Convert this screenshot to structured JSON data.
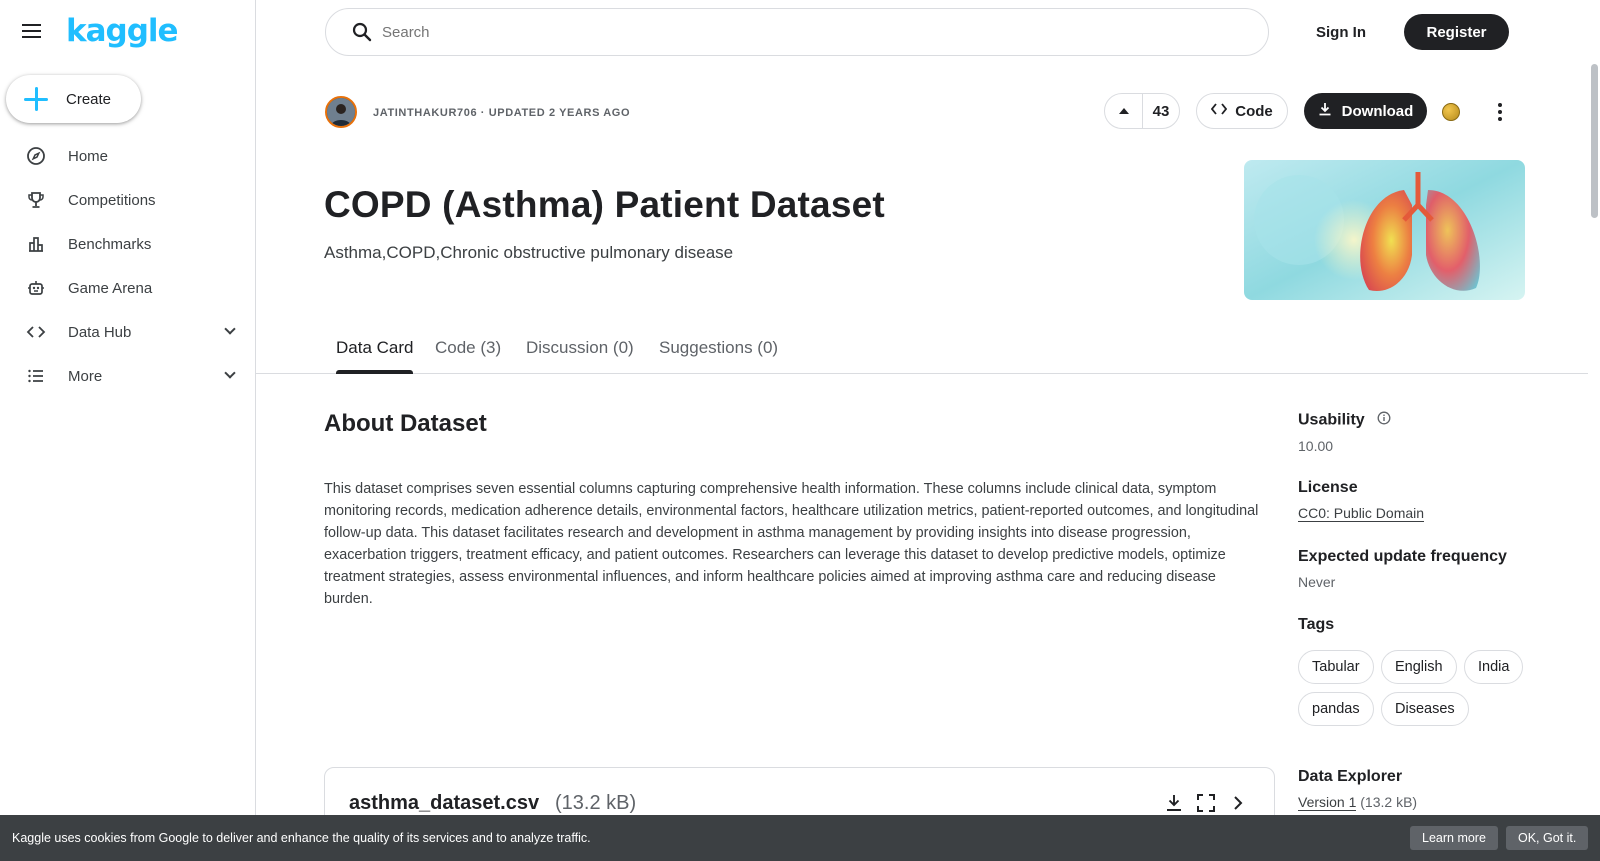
{
  "brand": {
    "logo_text": "kaggle",
    "accent": "#20beff"
  },
  "sidebar": {
    "create_label": "Create",
    "items": [
      {
        "label": "Home",
        "icon": "compass-icon"
      },
      {
        "label": "Competitions",
        "icon": "trophy-icon"
      },
      {
        "label": "Benchmarks",
        "icon": "bar-chart-icon"
      },
      {
        "label": "Game Arena",
        "icon": "robot-icon"
      },
      {
        "label": "Data Hub",
        "icon": "code-icon"
      },
      {
        "label": "More",
        "icon": "list-icon"
      }
    ]
  },
  "topbar": {
    "search_placeholder": "Search",
    "signin_label": "Sign In",
    "register_label": "Register"
  },
  "dataset": {
    "meta": "JATINTHAKUR706 · UPDATED 2 YEARS AGO",
    "upvotes": "43",
    "code_label": "Code",
    "download_label": "Download",
    "title": "COPD (Asthma) Patient Dataset",
    "subtitle": "Asthma,COPD,Chronic obstructive pulmonary disease"
  },
  "tabs": [
    {
      "label": "Data Card",
      "active": true
    },
    {
      "label": "Code (3)",
      "active": false
    },
    {
      "label": "Discussion (0)",
      "active": false
    },
    {
      "label": "Suggestions (0)",
      "active": false
    }
  ],
  "about": {
    "heading": "About Dataset",
    "description": "This dataset comprises seven essential columns capturing comprehensive health information. These columns include clinical data, symptom monitoring records, medication adherence details, environmental factors, healthcare utilization metrics, patient-reported outcomes, and longitudinal follow-up data. This dataset facilitates research and development in asthma management by providing insights into disease progression, exacerbation triggers, treatment efficacy, and patient outcomes. Researchers can leverage this dataset to develop predictive models, optimize treatment strategies, assess environmental influences, and inform healthcare policies aimed at improving asthma care and reducing disease burden."
  },
  "file": {
    "name": "asthma_dataset.csv",
    "size": "(13.2 kB)"
  },
  "panel": {
    "usability_label": "Usability",
    "usability_value": "10.00",
    "license_label": "License",
    "license_value": "CC0: Public Domain",
    "frequency_label": "Expected update frequency",
    "frequency_value": "Never",
    "tags_label": "Tags",
    "tags": [
      "Tabular",
      "English",
      "India",
      "pandas",
      "Diseases"
    ],
    "explorer_label": "Data Explorer",
    "explorer_version": "Version 1",
    "explorer_size": "(13.2 kB)"
  },
  "cookie": {
    "text": "Kaggle uses cookies from Google to deliver and enhance the quality of its services and to analyze traffic.",
    "learn_more": "Learn more",
    "ok": "OK, Got it."
  }
}
